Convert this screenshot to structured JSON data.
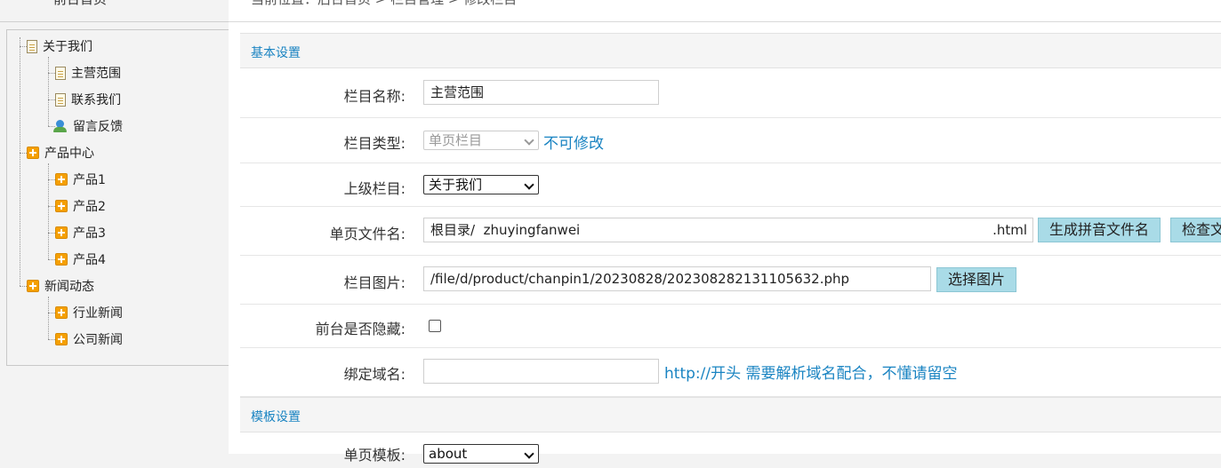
{
  "sidebar": {
    "top_link": "前台首页",
    "tree": [
      {
        "label": "关于我们",
        "icon": "document-icon"
      },
      {
        "label": "主营范围",
        "icon": "document-icon"
      },
      {
        "label": "联系我们",
        "icon": "document-icon"
      },
      {
        "label": "留言反馈",
        "icon": "user-feedback-icon"
      },
      {
        "label": "产品中心",
        "icon": "folder-plus-icon"
      },
      {
        "label": "产品1",
        "icon": "folder-plus-icon"
      },
      {
        "label": "产品2",
        "icon": "folder-plus-icon"
      },
      {
        "label": "产品3",
        "icon": "folder-plus-icon"
      },
      {
        "label": "产品4",
        "icon": "folder-plus-icon"
      },
      {
        "label": "新闻动态",
        "icon": "folder-plus-icon"
      },
      {
        "label": "行业新闻",
        "icon": "folder-plus-icon"
      },
      {
        "label": "公司新闻",
        "icon": "folder-plus-icon"
      }
    ]
  },
  "breadcrumb": "当前位置：后台首页 > 栏目管理 > 修改栏目",
  "sections": {
    "basic": "基本设置",
    "template": "模板设置"
  },
  "form": {
    "name": {
      "label": "栏目名称:",
      "value": "主营范围"
    },
    "type": {
      "label": "栏目类型:",
      "value": "单页栏目",
      "note": "不可修改"
    },
    "parent": {
      "label": "上级栏目:",
      "value": "关于我们"
    },
    "filename": {
      "label": "单页文件名:",
      "prefix": "根目录/",
      "value": "zhuyingfanwei",
      "suffix": ".html",
      "gen_button": "生成拼音文件名",
      "check_button": "检查文件名"
    },
    "image": {
      "label": "栏目图片:",
      "value": "/file/d/product/chanpin1/20230828/20230828213110563​2.php",
      "button": "选择图片"
    },
    "hidden": {
      "label": "前台是否隐藏:",
      "checked": false
    },
    "domain": {
      "label": "绑定域名:",
      "value": "",
      "hint": "http://开头 需要解析域名配合，不懂请留空"
    },
    "page_template": {
      "label": "单页模板:",
      "value": "about"
    }
  },
  "colors": {
    "accent": "#1a84c2",
    "button_bg": "#a9dbe7"
  }
}
